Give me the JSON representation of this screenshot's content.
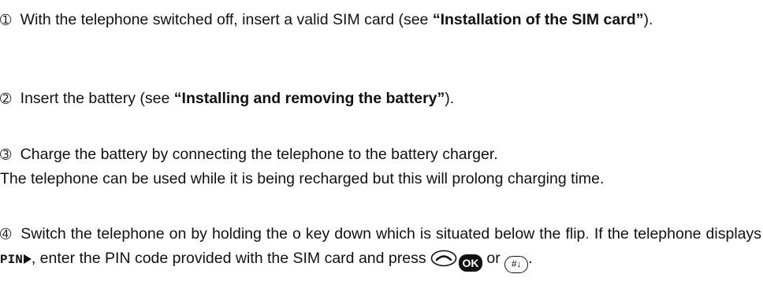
{
  "steps": [
    {
      "number": "➀",
      "text_a": "With the telephone switched off, insert a valid SIM card (see ",
      "bold": "“Installation of the SIM card”",
      "text_b": ")."
    },
    {
      "number": "➁",
      "text_a": "Insert the battery (see ",
      "bold": "“Installing and removing the battery”",
      "text_b": ")."
    },
    {
      "number": "➂",
      "line1": "Charge the battery by connecting the telephone to the battery charger.",
      "line2": "The telephone can be used while it is being recharged but this will prolong charging time."
    },
    {
      "number": "➃",
      "text_a": "Switch the telephone on by holding the o key down which is situated below the flip",
      "dot": ".",
      "text_b": " If the telephone displays ",
      "display_text": "PIN",
      "text_c": ", enter the PIN code provided with the SIM card and press ",
      "ok_label": "OK",
      "or_text": " or ",
      "hash_label": "#↓",
      "end": "."
    }
  ],
  "icons": {
    "call_key": "call-key-icon",
    "ok_key": "ok-key-icon",
    "hash_key": "hash-key-icon",
    "play_arrow": "play-arrow-icon"
  }
}
